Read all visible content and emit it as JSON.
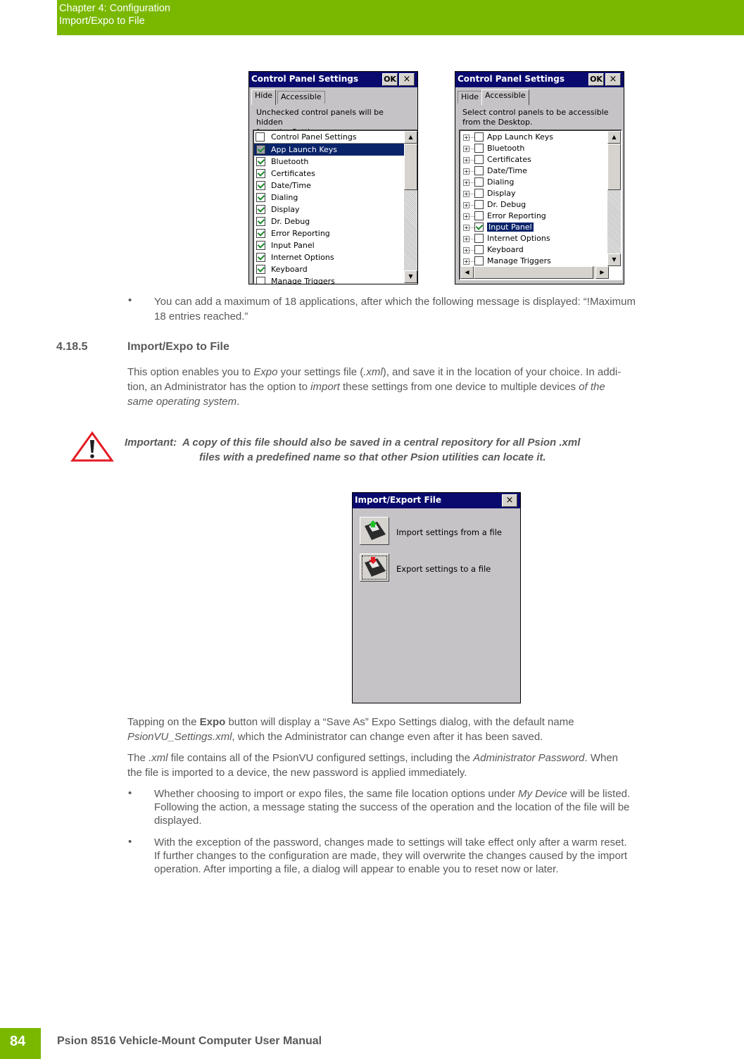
{
  "header": {
    "chapter": "Chapter 4:  Configuration",
    "section": "Import/Expo to File"
  },
  "dialog_hide": {
    "title": "Control Panel Settings",
    "ok_label": "OK",
    "close_label": "×",
    "tabs": [
      "Hide",
      "Accessible"
    ],
    "active_tab": "Hide",
    "description_line1": "Unchecked control panels will be hidden",
    "description_line2": "from the Settings screen.",
    "list_header": "Control Panel Settings",
    "items": [
      {
        "label": "App Launch Keys",
        "checked": true,
        "selected": true
      },
      {
        "label": "Bluetooth",
        "checked": true
      },
      {
        "label": "Certificates",
        "checked": true
      },
      {
        "label": "Date/Time",
        "checked": true
      },
      {
        "label": "Dialing",
        "checked": true
      },
      {
        "label": "Display",
        "checked": true
      },
      {
        "label": "Dr. Debug",
        "checked": true
      },
      {
        "label": "Error Reporting",
        "checked": true
      },
      {
        "label": "Input Panel",
        "checked": true
      },
      {
        "label": "Internet Options",
        "checked": true
      },
      {
        "label": "Keyboard",
        "checked": true
      },
      {
        "label": "Manage Triggers",
        "checked": false
      }
    ]
  },
  "dialog_accessible": {
    "title": "Control Panel Settings",
    "ok_label": "OK",
    "close_label": "×",
    "tabs": [
      "Hide",
      "Accessible"
    ],
    "active_tab": "Accessible",
    "description_line1": "Select control panels to be accessible",
    "description_line2": "from the Desktop.",
    "items": [
      {
        "label": "App Launch Keys",
        "checked": false
      },
      {
        "label": "Bluetooth",
        "checked": false
      },
      {
        "label": "Certificates",
        "checked": false
      },
      {
        "label": "Date/Time",
        "checked": false
      },
      {
        "label": "Dialing",
        "checked": false
      },
      {
        "label": "Display",
        "checked": false
      },
      {
        "label": "Dr. Debug",
        "checked": false
      },
      {
        "label": "Error Reporting",
        "checked": false
      },
      {
        "label": "Input Panel",
        "checked": true,
        "selected": true
      },
      {
        "label": "Internet Options",
        "checked": false
      },
      {
        "label": "Keyboard",
        "checked": false
      },
      {
        "label": "Manage Triggers",
        "checked": false
      }
    ]
  },
  "bullet_max": {
    "line1": "You can add a maximum of 18 applications, after which the following message is displayed: “!Maximum",
    "line2": "18 entries reached.”"
  },
  "section": {
    "number": "4.18.5",
    "title": "Import/Expo to File"
  },
  "intro": {
    "p1_a": "This option enables you to ",
    "p1_expo": "Expo",
    "p1_b": " your settings file (",
    "p1_xml": ".xml",
    "p1_c": "), and save it in the location of your choice. In addi-",
    "p2_a": "tion, an Administrator has the option to ",
    "p2_import": "import",
    "p2_b": " these settings from one device to multiple devices ",
    "p2_of_the": "of the",
    "p3": "same operating system",
    "p3_end": "."
  },
  "important": {
    "label": "Important:",
    "line1": "A copy of this file should also be saved in a central repository for all Psion .xml",
    "line2": "files with a predefined name so that other Psion utilities can locate it."
  },
  "dialog_import_export": {
    "title": "Import/Export File",
    "close_label": "×",
    "import_label": "Import settings from a file",
    "export_label": "Export settings to a file"
  },
  "para_expo": {
    "a": "Tapping on the ",
    "bold": "Expo",
    "b": " button will display a “Save As” Expo Settings dialog, with the default name",
    "filename": "PsionVU_Settings.xml",
    "c": ", which the Administrator can change even after it has been saved."
  },
  "para_xml": {
    "a": "The ",
    "xml": ".xml",
    "b": " file contains all of the PsionVU configured settings, including the ",
    "admin": "Administrator Password",
    "c": ". When",
    "line2": "the file is imported to a device, the new password is applied immediately."
  },
  "bullet_location": {
    "a": "Whether choosing to import or expo files, the same file location options under ",
    "my_device": "My Device",
    "b": " will be listed.",
    "line2": "Following the action, a message stating the success of the operation and the location of the file will be",
    "line3": "displayed."
  },
  "bullet_reset": {
    "line1": "With the exception of the password, changes made to settings will take effect only after a warm reset.",
    "line2": "If further changes to the configuration are made, they will overwrite the changes caused by the import",
    "line3": "operation. After importing a file, a dialog will appear to enable you to reset now or later."
  },
  "footer": {
    "page_number": "84",
    "manual_title": "Psion 8516 Vehicle-Mount Computer User Manual"
  },
  "colors": {
    "brand_green": "#7ab800",
    "text_grey": "#58595b",
    "ce_titlebar": "#0a0a6e",
    "ce_face": "#c6c3c6",
    "warning_red": "#e31b23"
  }
}
